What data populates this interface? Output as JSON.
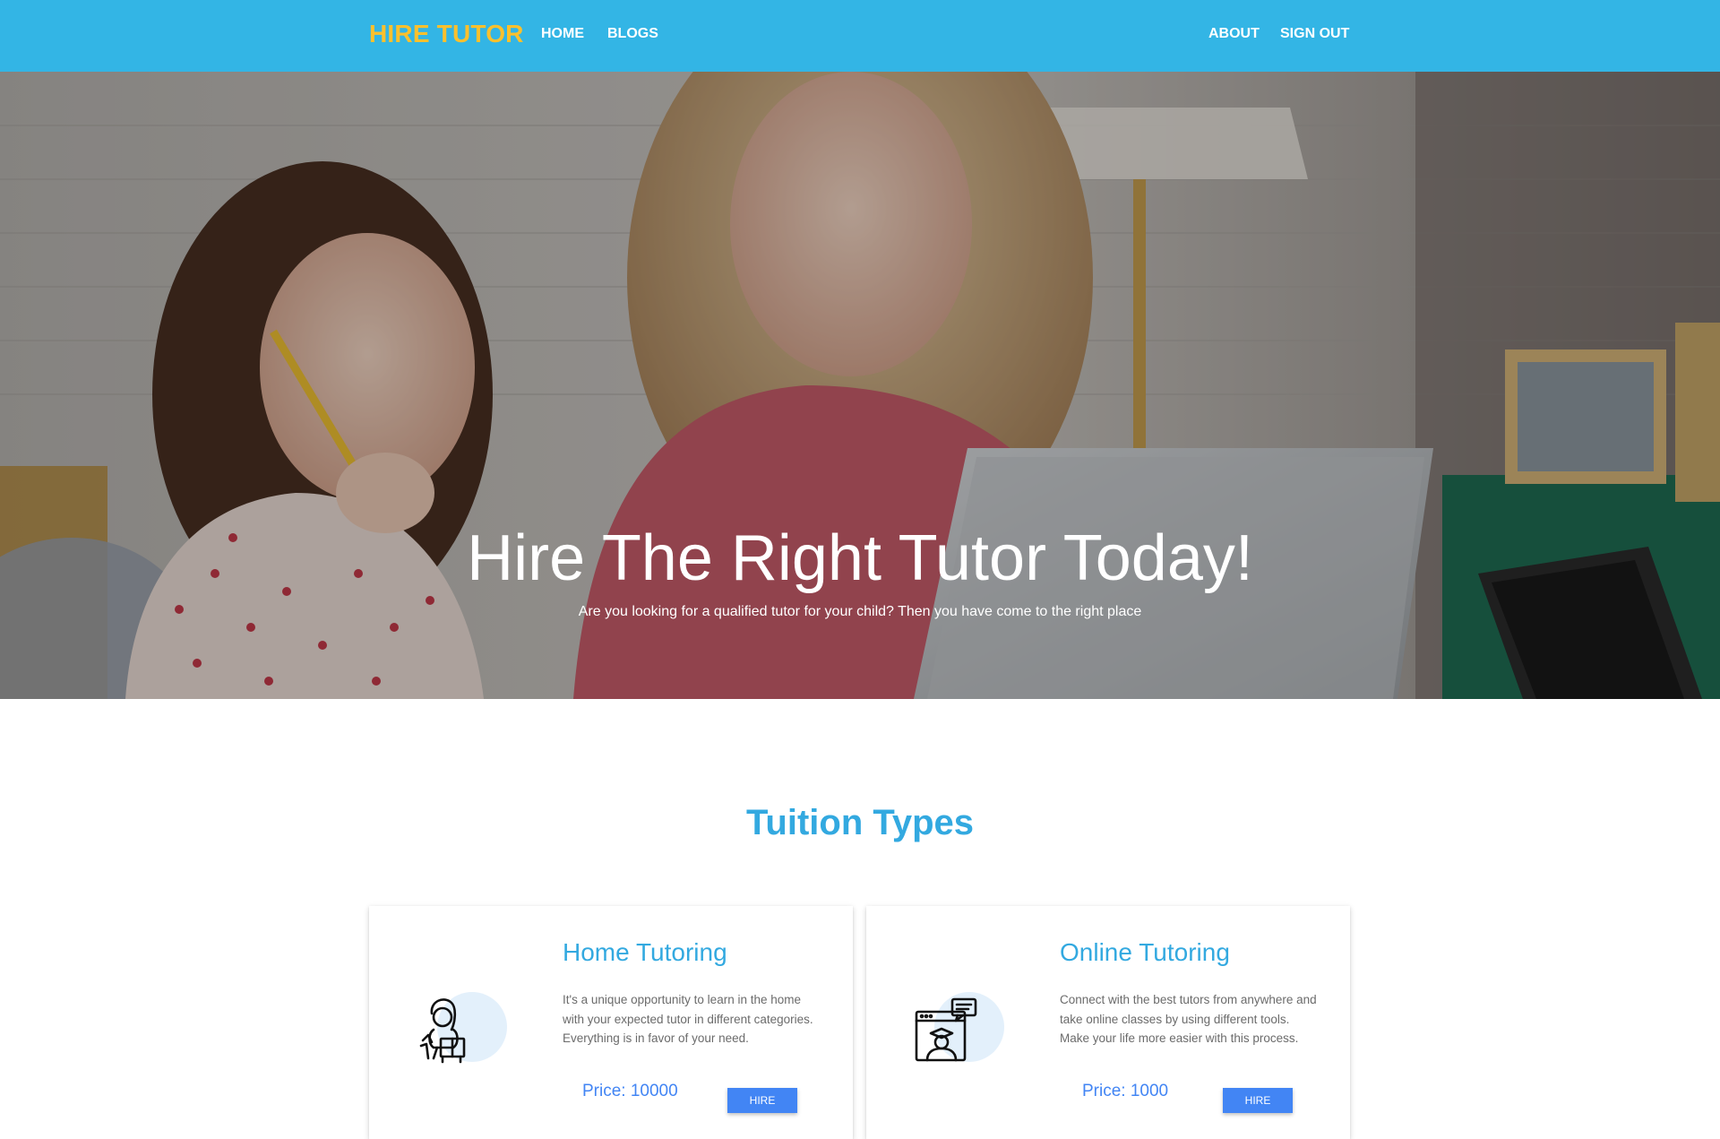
{
  "navbar": {
    "brand": "HIRE TUTOR",
    "links_left": [
      "HOME",
      "BLOGS"
    ],
    "links_right": [
      "ABOUT",
      "SIGN OUT"
    ],
    "background": "#33b5e5",
    "brand_color": "#fbc02d"
  },
  "hero": {
    "title": "Hire The Right Tutor Today!",
    "subtitle": "Are you looking for a qualified tutor for your child? Then you have come to the right place",
    "image": "photo of woman and girl studying at a laptop"
  },
  "section": {
    "title": "Tuition Types",
    "title_color": "#33a9e0"
  },
  "cards": [
    {
      "title": "Home Tutoring",
      "text": "It's a unique opportunity to learn in the home with your expected tutor in different categories. Everything is in favor of your need.",
      "price": "Price: 10000",
      "button": "HIRE",
      "icon": "girl-reading-book-icon"
    },
    {
      "title": "Online Tutoring",
      "text": "Connect with the best tutors from anywhere and take online classes by using different tools. Make your life more easier with this process.",
      "price": "Price: 1000",
      "button": "HIRE",
      "icon": "online-teacher-screen-icon"
    }
  ],
  "colors": {
    "accent_blue": "#4285f4",
    "heading_blue": "#33a9e0"
  }
}
